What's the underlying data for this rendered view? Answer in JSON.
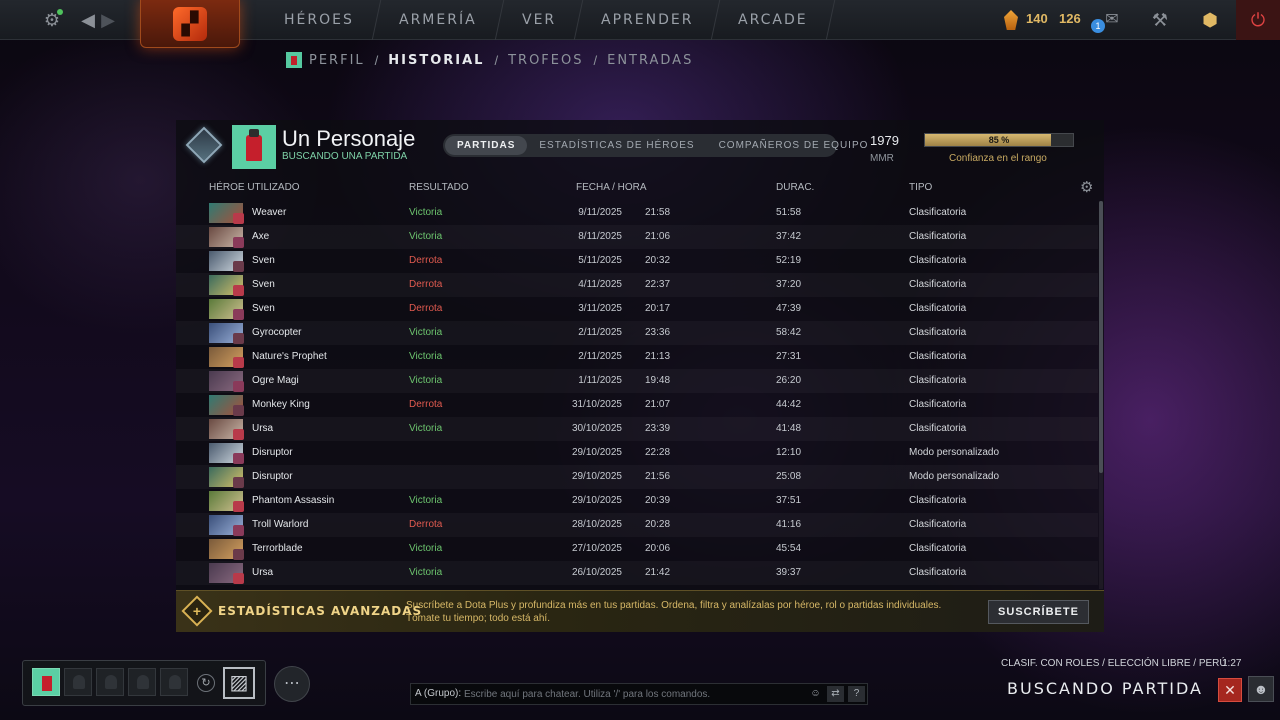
{
  "nav": {
    "items": [
      "HÉROES",
      "ARMERÍA",
      "VER",
      "APRENDER",
      "ARCADE"
    ]
  },
  "top": {
    "shards": "140",
    "points": "126",
    "notifications": "1"
  },
  "subnav": {
    "items": [
      "PERFIL",
      "HISTORIAL",
      "TROFEOS",
      "ENTRADAS"
    ]
  },
  "profile": {
    "name": "Un Personaje",
    "status": "BUSCANDO UNA PARTIDA",
    "tabs": [
      "PARTIDAS",
      "ESTADÍSTICAS DE HÉROES",
      "COMPAÑEROS DE EQUIPO"
    ],
    "mmr": "1979",
    "mmr_label": "MMR",
    "confidence": 0.85,
    "confidence_text": "85 %",
    "confidence_label": "Confianza en el rango"
  },
  "table": {
    "headers": [
      "HÉROE UTILIZADO",
      "RESULTADO",
      "FECHA / HORA",
      "DURAC.",
      "TIPO"
    ],
    "rows": [
      {
        "hero": "Weaver",
        "result": "Victoria",
        "date": "9/11/2025",
        "time": "21:58",
        "duration": "51:58",
        "type": "Clasificatoria"
      },
      {
        "hero": "Axe",
        "result": "Victoria",
        "date": "8/11/2025",
        "time": "21:06",
        "duration": "37:42",
        "type": "Clasificatoria"
      },
      {
        "hero": "Sven",
        "result": "Derrota",
        "date": "5/11/2025",
        "time": "20:32",
        "duration": "52:19",
        "type": "Clasificatoria"
      },
      {
        "hero": "Sven",
        "result": "Derrota",
        "date": "4/11/2025",
        "time": "22:37",
        "duration": "37:20",
        "type": "Clasificatoria"
      },
      {
        "hero": "Sven",
        "result": "Derrota",
        "date": "3/11/2025",
        "time": "20:17",
        "duration": "47:39",
        "type": "Clasificatoria"
      },
      {
        "hero": "Gyrocopter",
        "result": "Victoria",
        "date": "2/11/2025",
        "time": "23:36",
        "duration": "58:42",
        "type": "Clasificatoria"
      },
      {
        "hero": "Nature's Prophet",
        "result": "Victoria",
        "date": "2/11/2025",
        "time": "21:13",
        "duration": "27:31",
        "type": "Clasificatoria"
      },
      {
        "hero": "Ogre Magi",
        "result": "Victoria",
        "date": "1/11/2025",
        "time": "19:48",
        "duration": "26:20",
        "type": "Clasificatoria"
      },
      {
        "hero": "Monkey King",
        "result": "Derrota",
        "date": "31/10/2025",
        "time": "21:07",
        "duration": "44:42",
        "type": "Clasificatoria"
      },
      {
        "hero": "Ursa",
        "result": "Victoria",
        "date": "30/10/2025",
        "time": "23:39",
        "duration": "41:48",
        "type": "Clasificatoria"
      },
      {
        "hero": "Disruptor",
        "result": "",
        "date": "29/10/2025",
        "time": "22:28",
        "duration": "12:10",
        "type": "Modo personalizado"
      },
      {
        "hero": "Disruptor",
        "result": "",
        "date": "29/10/2025",
        "time": "21:56",
        "duration": "25:08",
        "type": "Modo personalizado"
      },
      {
        "hero": "Phantom Assassin",
        "result": "Victoria",
        "date": "29/10/2025",
        "time": "20:39",
        "duration": "37:51",
        "type": "Clasificatoria"
      },
      {
        "hero": "Troll Warlord",
        "result": "Derrota",
        "date": "28/10/2025",
        "time": "20:28",
        "duration": "41:16",
        "type": "Clasificatoria"
      },
      {
        "hero": "Terrorblade",
        "result": "Victoria",
        "date": "27/10/2025",
        "time": "20:06",
        "duration": "45:54",
        "type": "Clasificatoria"
      },
      {
        "hero": "Ursa",
        "result": "Victoria",
        "date": "26/10/2025",
        "time": "21:42",
        "duration": "39:37",
        "type": "Clasificatoria"
      }
    ]
  },
  "promo": {
    "title": "ESTADÍSTICAS AVANZADAS",
    "line1": "Suscríbete a Dota Plus y profundiza más en tus partidas. Ordena, filtra y analízalas por héroe, rol o partidas individuales.",
    "line2": "Tómate tu tiempo; todo está ahí.",
    "button": "SUSCRÍBETE"
  },
  "chat": {
    "label": "A (Grupo):",
    "placeholder": "Escribe aquí para chatear. Utiliza '/' para los comandos.",
    "help": "?"
  },
  "matchmaking": {
    "mode": "CLASIF. CON ROLES / ELECCIÓN LIBRE / PERÚ",
    "timer": "1:27",
    "title": "BUSCANDO PARTIDA"
  },
  "colors": {
    "win": "#6cc46e",
    "loss": "#e05a4f",
    "gold": "#d6b870",
    "accent_green": "#5bcfa4"
  },
  "icons": [
    "settings-icon",
    "back-icon",
    "forward-icon",
    "dota-logo",
    "shards-icon",
    "mail-icon",
    "armory-icon",
    "dota-plus-icon",
    "power-icon",
    "table-settings-icon",
    "emoji-icon",
    "translate-icon",
    "help-icon",
    "cancel-icon",
    "person-icon"
  ]
}
